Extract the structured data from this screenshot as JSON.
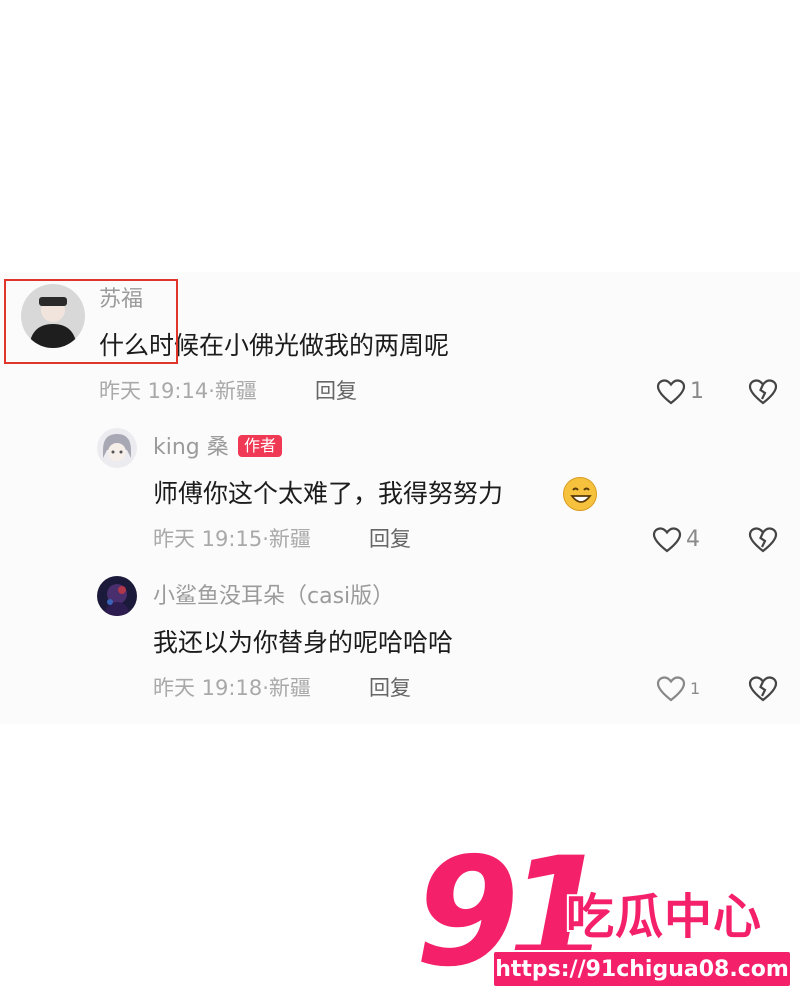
{
  "comments": [
    {
      "username": "苏福",
      "text": "什么时候在小佛光做我的两周呢",
      "time": "昨天 19:14",
      "location": "新疆",
      "reply_label": "回复",
      "likes": "1"
    },
    {
      "username": "king 桑",
      "badge": "作者",
      "text": "师傅你这个太难了，我得努努力",
      "time": "昨天 19:15",
      "location": "新疆",
      "reply_label": "回复",
      "likes": "4"
    },
    {
      "username": "小鲨鱼没耳朵（casi版）",
      "text": "我还以为你替身的呢哈哈哈",
      "time": "昨天 19:18",
      "location": "新疆",
      "reply_label": "回复",
      "likes": "1"
    }
  ],
  "icons": {
    "like": "heart-outline-icon",
    "dislike": "broken-heart-icon",
    "emoji": "grinning-emoji-icon"
  },
  "colors": {
    "author_badge": "#f03a55",
    "highlight_box": "#e0352b",
    "watermark": "#f4206a"
  },
  "watermark": {
    "logo_number": "91",
    "title": "吃瓜中心",
    "url": "https://91chigua08.com"
  }
}
